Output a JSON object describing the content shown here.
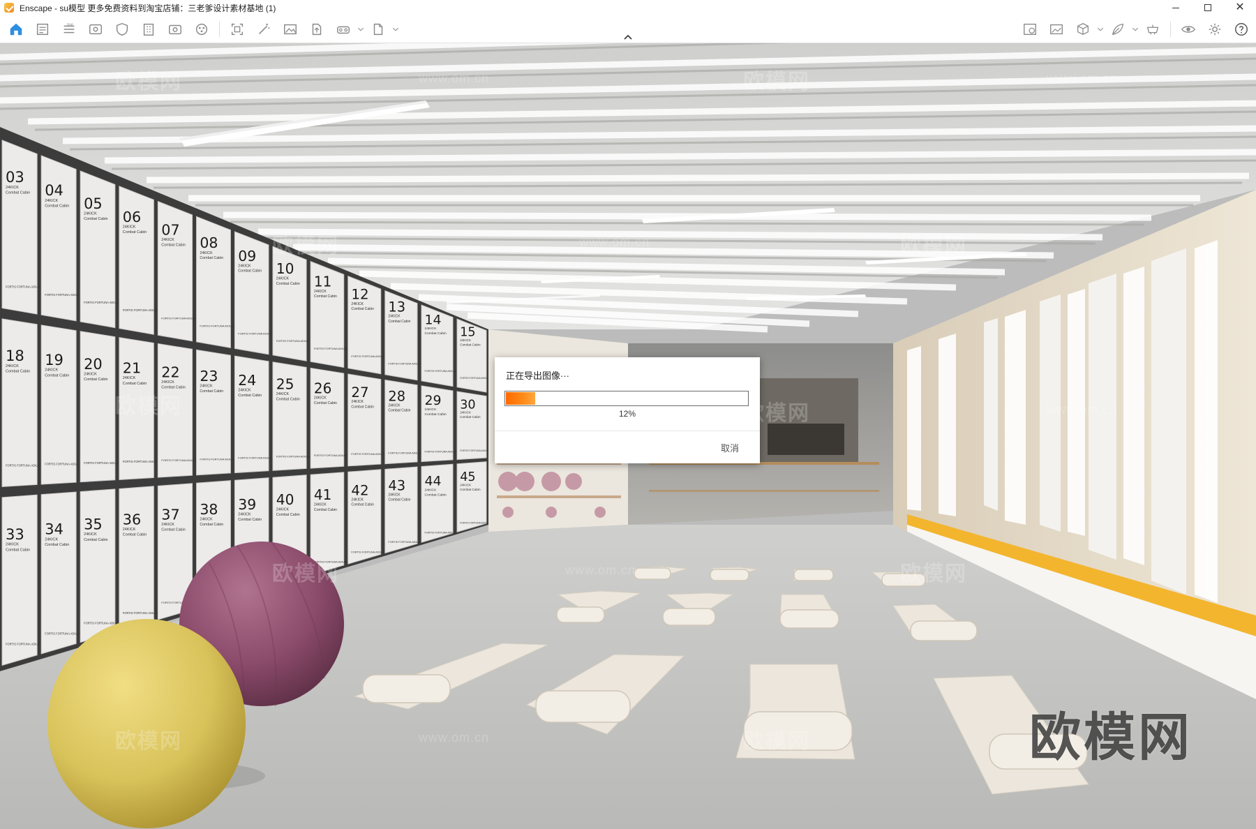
{
  "window": {
    "title": "Enscape - su模型  更多免费资料到淘宝店铺：三老爹设计素材基地 (1)",
    "controls": [
      "minimize",
      "maximize",
      "close"
    ]
  },
  "toolbar": {
    "left_icons": [
      "home-icon",
      "project-icon",
      "bim-icon",
      "view-icon",
      "settings-shield-icon",
      "building-icon",
      "video-icon",
      "asset-library-icon",
      "screenshot-icon",
      "magic-icon",
      "image-icon",
      "upload-icon",
      "vr-icon",
      "export-icon"
    ],
    "right_icons": [
      "render-image-icon",
      "gallery-icon",
      "cube-icon",
      "leaf-icon",
      "camera-icon",
      "visibility-icon",
      "settings-gear-icon",
      "help-icon"
    ]
  },
  "scene": {
    "lockers_top": [
      "03",
      "04",
      "05",
      "06",
      "07",
      "08",
      "09",
      "10",
      "11",
      "12",
      "13",
      "14",
      "15"
    ],
    "lockers_mid": [
      "18",
      "19",
      "20",
      "21",
      "22",
      "23",
      "24",
      "25",
      "26",
      "27",
      "28",
      "29",
      "30"
    ],
    "lockers_bot": [
      "33",
      "34",
      "35",
      "36",
      "37",
      "38",
      "39",
      "40",
      "41",
      "42",
      "43",
      "44",
      "45"
    ],
    "locker_brand": "24KICK",
    "locker_subtitle": "Combat Cabin",
    "locker_motto": "FORTIS FORTUNA ADIUVAT",
    "watermarks": [
      "欧模网",
      "www.om.cn"
    ],
    "logo": "欧模网",
    "colors": {
      "ceiling": "#d8d8d6",
      "floor": "#c7c7c5",
      "locker": "#ecebea",
      "ball_yellow": "#d8c25a",
      "ball_purple": "#8a4a6a",
      "bench": "#f3b52e",
      "mat": "#ece6dc"
    }
  },
  "dialog": {
    "title": "正在导出图像···",
    "progress": 12,
    "progress_label": "12%",
    "cancel_label": "取消",
    "accent": "#ff7a10"
  }
}
